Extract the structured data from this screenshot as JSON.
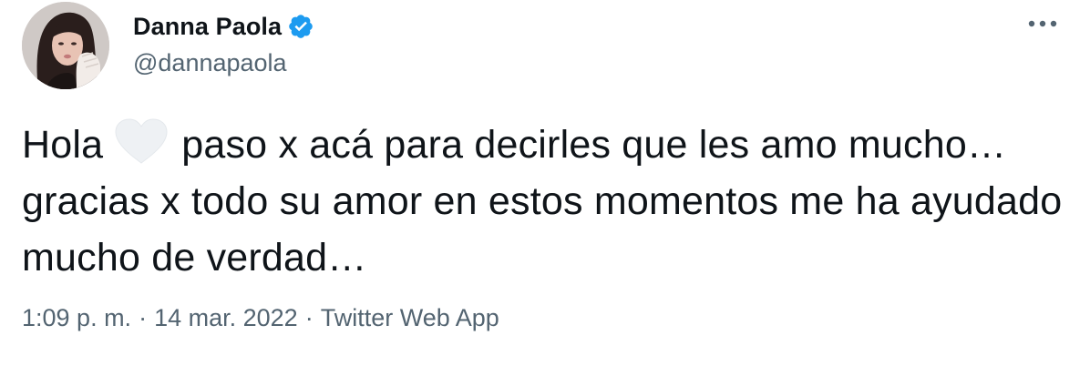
{
  "author": {
    "display_name": "Danna Paola",
    "handle": "@dannapaola",
    "verified": true
  },
  "more_icon": "more-horizontal-icon",
  "tweet": {
    "text_before_emoji": "Hola",
    "emoji": "white-heart-icon",
    "text_after_emoji": "paso x acá para decirles que les amo mucho… gracias x todo su amor en estos momentos me ha ayudado mucho de verdad…"
  },
  "meta": {
    "time": "1:09 p. m.",
    "separator": "·",
    "date": "14 mar. 2022",
    "source": "Twitter Web App"
  },
  "colors": {
    "text_primary": "#0f1419",
    "text_secondary": "#536471",
    "verified_blue": "#1d9bf0"
  }
}
